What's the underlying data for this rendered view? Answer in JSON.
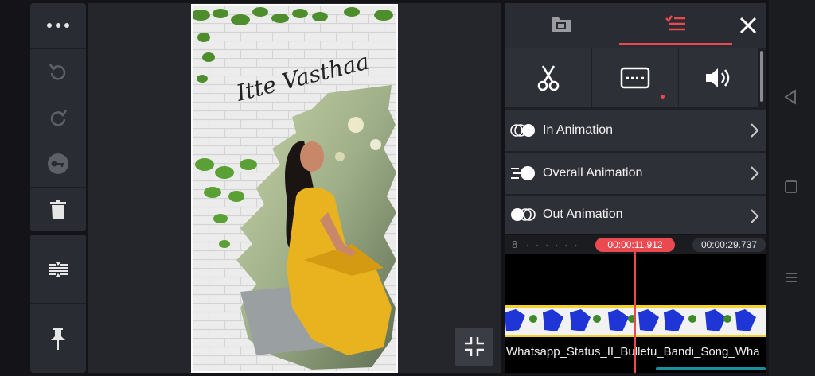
{
  "preview": {
    "title_text": "Itte Vasthaa"
  },
  "right_panel": {
    "animations": [
      {
        "label": "In Animation"
      },
      {
        "label": "Overall Animation"
      },
      {
        "label": "Out Animation"
      }
    ]
  },
  "timeline": {
    "ruler_mark": "8",
    "current_time": "00:00:11.912",
    "total_time": "00:00:29.737",
    "clip_name": "Whatsapp_Status_II_Bulletu_Bandi_Song_Wha"
  },
  "colors": {
    "accent": "#ea4a4f",
    "panel": "#2a2c33",
    "background": "#141418"
  }
}
